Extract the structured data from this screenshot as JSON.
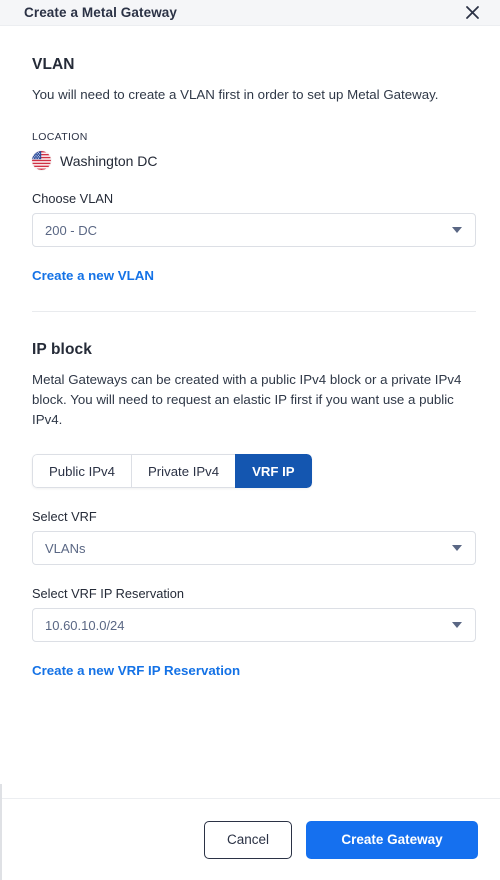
{
  "header": {
    "title": "Create a Metal Gateway",
    "close_icon": "close-icon"
  },
  "vlan_section": {
    "title": "VLAN",
    "description": "You will need to create a VLAN first in order to set up Metal Gateway.",
    "location_label": "LOCATION",
    "location_icon": "us-flag-icon",
    "location_value": "Washington DC",
    "choose_vlan_label": "Choose VLAN",
    "choose_vlan_value": "200 - DC",
    "create_vlan_link": "Create a new VLAN"
  },
  "ip_block_section": {
    "title": "IP block",
    "description": "Metal Gateways can be created with a public IPv4 block or a private IPv4 block. You will need to request an elastic IP first if you want use a public IPv4.",
    "tabs": [
      {
        "label": "Public IPv4",
        "active": false
      },
      {
        "label": "Private IPv4",
        "active": false
      },
      {
        "label": "VRF IP",
        "active": true
      }
    ],
    "select_vrf_label": "Select VRF",
    "select_vrf_value": "VLANs",
    "select_vrf_reservation_label": "Select VRF IP Reservation",
    "select_vrf_reservation_value": "10.60.10.0/24",
    "create_reservation_link": "Create a new VRF IP Reservation"
  },
  "footer": {
    "cancel_label": "Cancel",
    "submit_label": "Create Gateway"
  },
  "colors": {
    "accent_primary": "#1570ef",
    "accent_tab_active": "#1456b0",
    "link": "#1472e6",
    "header_bg": "#f5f6f8",
    "border": "#dcdfe5",
    "text": "#2b3245",
    "muted_text": "#5a6784"
  }
}
